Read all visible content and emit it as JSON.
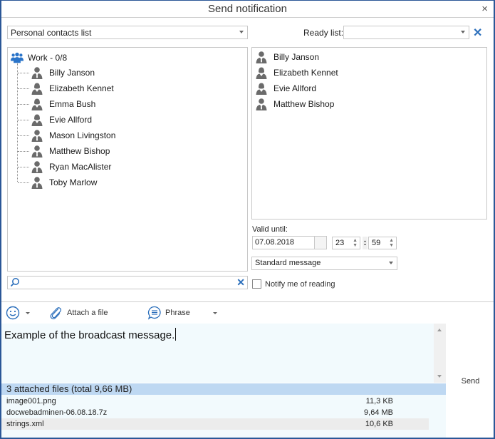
{
  "window": {
    "title": "Send notification",
    "close_label": "×"
  },
  "top": {
    "contacts_list_selected": "Personal contacts list",
    "ready_list_label": "Ready list:",
    "ready_list_selected": "",
    "ready_clear_label": "✕"
  },
  "tree": {
    "group_label": "Work - 0/8",
    "contacts": [
      {
        "name": "Billy Janson",
        "gender": "male"
      },
      {
        "name": "Elizabeth Kennet",
        "gender": "female"
      },
      {
        "name": "Emma Bush",
        "gender": "female"
      },
      {
        "name": "Evie Allford",
        "gender": "female"
      },
      {
        "name": "Mason Livingston",
        "gender": "male"
      },
      {
        "name": "Matthew Bishop",
        "gender": "male"
      },
      {
        "name": "Ryan MacAlister",
        "gender": "male"
      },
      {
        "name": "Toby Marlow",
        "gender": "male"
      }
    ]
  },
  "selected": {
    "contacts": [
      {
        "name": "Billy Janson",
        "gender": "male"
      },
      {
        "name": "Elizabeth Kennet",
        "gender": "female"
      },
      {
        "name": "Evie Allford",
        "gender": "female"
      },
      {
        "name": "Matthew Bishop",
        "gender": "male"
      }
    ]
  },
  "search": {
    "value": "",
    "clear_label": "✕"
  },
  "validity": {
    "label": "Valid until:",
    "date": "07.08.2018",
    "hour": "23",
    "minute": "59",
    "separator": ":"
  },
  "message_type": {
    "selected": "Standard message"
  },
  "notify": {
    "label": "Notify me of reading",
    "checked": false
  },
  "toolbar": {
    "attach_label": "Attach a file",
    "phrase_label": "Phrase"
  },
  "message": {
    "text": "Example of the broadcast message."
  },
  "send": {
    "label": "Send"
  },
  "attachments": {
    "header": "3 attached files (total 9,66 MB)",
    "files": [
      {
        "name": "image001.png",
        "size": "11,3 KB"
      },
      {
        "name": "docwebadminen-06.08.18.7z",
        "size": "9,64 MB"
      },
      {
        "name": "strings.xml",
        "size": "10,6 KB"
      }
    ]
  },
  "colors": {
    "accent": "#2a6ebb",
    "window_border": "#2b5797",
    "attach_header_bg": "#bed8f2",
    "message_bg": "#f2fafd",
    "icon_gray": "#6b6b6b",
    "group_icon": "#2a74c9"
  }
}
